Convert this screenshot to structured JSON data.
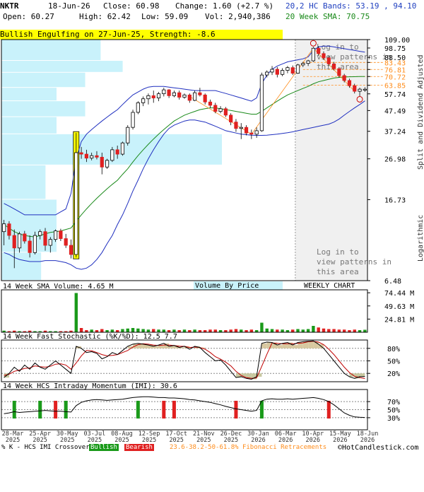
{
  "header": {
    "symbol": "NKTR",
    "date": "18-Jun-26",
    "close": "Close: 60.98",
    "change": "Change: 1.60 (+2.7 %)",
    "open": "Open: 60.27",
    "high": "High: 62.42",
    "low": "Low: 59.09",
    "vol": "Vol: 2,940,386",
    "bands": "20,2 HC Bands: 53.19 , 94.10",
    "sma": "20 Week SMA: 70.75"
  },
  "pattern_label": "Bullish Engulfing on 27-Jun-25, Strength: -8.6",
  "login_notice": "Log in to view patterns in this area",
  "side_labels": {
    "right_top": "Split and Dividend Adjusted",
    "right_bottom": "Logarithmic"
  },
  "colors": {
    "up": "#1a9a1a",
    "down": "#e02020",
    "sma": "#1a8a1a",
    "bands": "#1f2fbf",
    "vbp": "#c9f2fb",
    "fib": "#ff8c1a",
    "stoch_k": "#000000",
    "stoch_d": "#c00000",
    "highlight": "#ffff00"
  },
  "footer": {
    "legend": "% K - HCS IMI Crossover,",
    "bull": "Bullish",
    "bear": "Bearish",
    "fib": "23.6-38.2-50-61.8% Fibonacci Retracements",
    "copyright": "©HotCandlestick.com"
  },
  "chart_data": [
    {
      "type": "candlestick",
      "title": "NKTR",
      "yscale": "log",
      "ylim": [
        6.48,
        109.0
      ],
      "y_ticks": [
        "109.00",
        "98.75",
        "88.50",
        "83.43",
        "76.81",
        "70.72",
        "63.85",
        "57.74",
        "47.49",
        "37.24",
        "26.98",
        "16.73",
        "6.48"
      ],
      "fib_levels": [
        "83.43",
        "76.81",
        "70.72",
        "63.85"
      ],
      "x_labels": [
        "28-Mar\n2025",
        "25-Apr\n2025",
        "30-May\n2025",
        "03-Jul\n2025",
        "08-Aug\n2025",
        "12-Sep\n2025",
        "17-Oct\n2025",
        "21-Nov\n2025",
        "26-Dec\n2025",
        "30-Jan\n2026",
        "06-Mar\n2026",
        "10-Apr\n2026",
        "15-May\n2026",
        "18-Jun\n2026"
      ],
      "labels": {
        "volume_by_price": "Volume By Price",
        "chart_kind": "WEEKLY CHART"
      },
      "candles": [
        [
          11.5,
          13.2,
          9.8,
          12.6
        ],
        [
          12.6,
          13.0,
          10.5,
          11.0
        ],
        [
          11.0,
          11.8,
          7.5,
          9.5
        ],
        [
          9.5,
          11.5,
          9.0,
          11.2
        ],
        [
          11.2,
          11.6,
          10.0,
          10.3
        ],
        [
          10.3,
          11.0,
          8.5,
          9.0
        ],
        [
          9.0,
          11.5,
          8.8,
          11.0
        ],
        [
          11.0,
          11.8,
          10.5,
          11.5
        ],
        [
          11.5,
          12.0,
          9.2,
          9.8
        ],
        [
          9.8,
          10.8,
          9.0,
          10.5
        ],
        [
          10.5,
          11.8,
          10.2,
          11.6
        ],
        [
          11.6,
          11.9,
          10.3,
          10.6
        ],
        [
          10.6,
          11.2,
          9.5,
          9.8
        ],
        [
          9.8,
          10.5,
          8.4,
          8.8
        ],
        [
          8.8,
          36.5,
          8.5,
          29.0
        ],
        [
          29.0,
          31.0,
          27.0,
          28.5
        ],
        [
          28.5,
          30.0,
          26.0,
          27.2
        ],
        [
          27.2,
          29.0,
          26.5,
          28.0
        ],
        [
          28.0,
          29.5,
          26.8,
          27.5
        ],
        [
          27.5,
          29.0,
          22.5,
          24.5
        ],
        [
          24.5,
          27.0,
          24.0,
          26.5
        ],
        [
          26.5,
          31.0,
          26.0,
          30.0
        ],
        [
          30.0,
          31.5,
          27.0,
          28.5
        ],
        [
          28.5,
          33.0,
          28.0,
          32.5
        ],
        [
          32.5,
          40.0,
          31.5,
          39.0
        ],
        [
          39.0,
          48.0,
          38.0,
          46.5
        ],
        [
          46.5,
          53.0,
          45.5,
          52.0
        ],
        [
          52.0,
          56.0,
          50.0,
          54.5
        ],
        [
          54.5,
          58.0,
          51.0,
          56.5
        ],
        [
          56.5,
          60.0,
          52.0,
          55.0
        ],
        [
          55.0,
          59.0,
          53.0,
          57.8
        ],
        [
          57.8,
          62.0,
          56.0,
          60.5
        ],
        [
          60.5,
          61.0,
          55.0,
          56.5
        ],
        [
          56.5,
          60.0,
          55.5,
          58.5
        ],
        [
          58.5,
          60.0,
          54.0,
          55.5
        ],
        [
          55.5,
          58.0,
          54.5,
          57.0
        ],
        [
          57.0,
          58.0,
          52.0,
          53.5
        ],
        [
          53.5,
          60.0,
          53.0,
          58.5
        ],
        [
          58.5,
          62.0,
          56.0,
          57.0
        ],
        [
          57.0,
          58.0,
          51.0,
          52.5
        ],
        [
          52.5,
          54.0,
          49.0,
          50.5
        ],
        [
          50.5,
          52.0,
          46.0,
          47.0
        ],
        [
          47.0,
          50.0,
          46.0,
          48.5
        ],
        [
          48.5,
          49.5,
          44.0,
          45.0
        ],
        [
          45.0,
          46.0,
          40.0,
          41.5
        ],
        [
          41.5,
          43.0,
          37.0,
          38.5
        ],
        [
          38.5,
          41.0,
          34.0,
          39.0
        ],
        [
          39.0,
          40.0,
          35.5,
          36.5
        ],
        [
          36.5,
          38.0,
          34.0,
          36.0
        ],
        [
          36.0,
          39.0,
          34.5,
          37.5
        ],
        [
          37.5,
          74.0,
          37.0,
          72.0
        ],
        [
          72.0,
          76.0,
          70.0,
          74.5
        ],
        [
          74.5,
          80.0,
          72.0,
          77.0
        ],
        [
          77.0,
          79.0,
          70.0,
          72.5
        ],
        [
          72.5,
          78.0,
          71.0,
          76.0
        ],
        [
          76.0,
          80.0,
          73.5,
          78.5
        ],
        [
          78.5,
          80.5,
          72.0,
          73.5
        ],
        [
          73.5,
          82.0,
          73.0,
          81.0
        ],
        [
          81.0,
          84.0,
          79.0,
          82.5
        ],
        [
          82.5,
          86.0,
          80.0,
          85.0
        ],
        [
          85.0,
          100.0,
          84.0,
          98.5
        ],
        [
          98.5,
          101.0,
          90.0,
          92.5
        ],
        [
          92.5,
          95.0,
          86.0,
          88.0
        ],
        [
          88.0,
          90.0,
          80.0,
          82.0
        ],
        [
          82.0,
          84.0,
          76.0,
          77.5
        ],
        [
          77.5,
          79.0,
          70.0,
          71.5
        ],
        [
          71.5,
          73.0,
          66.0,
          67.5
        ],
        [
          67.5,
          69.0,
          62.0,
          63.5
        ],
        [
          63.5,
          65.0,
          58.0,
          59.5
        ],
        [
          59.5,
          62.0,
          56.0,
          61.0
        ],
        [
          60.3,
          62.4,
          59.1,
          60.98
        ]
      ],
      "sma_20": [
        12.5,
        12.0,
        11.5,
        11.2,
        11.0,
        10.9,
        10.8,
        11.0,
        11.2,
        11.4,
        11.5,
        11.6,
        11.8,
        12.0,
        13.0,
        14.0,
        15.0,
        16.0,
        17.0,
        18.0,
        19.0,
        20.0,
        21.0,
        22.5,
        24.0,
        26.0,
        28.0,
        30.0,
        32.0,
        34.0,
        36.0,
        38.0,
        40.0,
        42.0,
        43.5,
        45.0,
        46.0,
        47.0,
        48.0,
        48.5,
        49.0,
        49.0,
        48.5,
        48.0,
        47.5,
        47.0,
        46.5,
        46.0,
        45.5,
        45.5,
        47.0,
        49.0,
        51.0,
        53.0,
        55.0,
        57.0,
        58.5,
        60.0,
        61.5,
        63.0,
        65.0,
        66.5,
        67.5,
        68.5,
        69.5,
        70.0,
        70.3,
        70.5,
        70.6,
        70.7,
        70.75
      ],
      "band_upper": [
        16.0,
        15.5,
        15.0,
        14.5,
        14.0,
        14.0,
        14.0,
        14.0,
        14.0,
        14.0,
        14.0,
        14.5,
        15.0,
        18.0,
        27.0,
        33.0,
        36.0,
        38.0,
        40.0,
        42.0,
        44.0,
        46.0,
        48.0,
        51.0,
        54.0,
        57.0,
        59.0,
        61.0,
        62.5,
        63.0,
        63.0,
        63.0,
        62.5,
        62.0,
        61.5,
        61.0,
        60.5,
        60.0,
        60.0,
        60.0,
        60.0,
        60.0,
        59.0,
        58.0,
        57.0,
        56.0,
        55.0,
        54.0,
        53.0,
        55.0,
        65.0,
        72.0,
        77.0,
        80.0,
        82.0,
        84.0,
        85.0,
        86.0,
        87.0,
        89.0,
        96.0,
        100.0,
        101.0,
        101.0,
        100.0,
        99.0,
        98.0,
        97.0,
        96.0,
        95.0,
        94.1
      ],
      "band_lower": [
        9.0,
        8.8,
        8.5,
        8.3,
        8.2,
        8.1,
        8.1,
        8.1,
        8.2,
        8.2,
        8.2,
        8.1,
        8.0,
        7.8,
        7.5,
        7.4,
        7.5,
        7.8,
        8.3,
        9.0,
        10.0,
        11.0,
        12.5,
        14.0,
        16.0,
        18.5,
        21.0,
        24.0,
        27.0,
        30.0,
        33.0,
        36.0,
        38.5,
        40.0,
        41.0,
        42.0,
        42.5,
        42.5,
        42.0,
        41.5,
        40.5,
        39.5,
        38.5,
        37.5,
        37.0,
        36.5,
        36.0,
        35.8,
        35.6,
        35.5,
        35.5,
        35.6,
        35.8,
        36.0,
        36.3,
        36.6,
        37.0,
        37.5,
        38.0,
        38.5,
        39.0,
        39.5,
        40.0,
        40.5,
        41.5,
        43.0,
        45.0,
        47.0,
        49.0,
        51.0,
        53.19
      ],
      "volume_by_price": [
        {
          "low": 6.48,
          "high": 9.0,
          "value": 0.18
        },
        {
          "low": 9.0,
          "high": 16.73,
          "value": 0.25
        },
        {
          "low": 16.73,
          "high": 25.0,
          "value": 0.2
        },
        {
          "low": 25.0,
          "high": 36.0,
          "value": 1.0
        },
        {
          "low": 36.0,
          "high": 44.0,
          "value": 0.25
        },
        {
          "low": 44.0,
          "high": 53.0,
          "value": 0.38
        },
        {
          "low": 53.0,
          "high": 62.0,
          "value": 0.25
        },
        {
          "low": 62.0,
          "high": 74.0,
          "value": 0.38
        },
        {
          "low": 74.0,
          "high": 85.0,
          "value": 0.55
        },
        {
          "low": 85.0,
          "high": 109.0,
          "value": 0.45
        }
      ]
    },
    {
      "type": "bar",
      "title": "14 Week SMA Volume: 4.65 M",
      "y_ticks": [
        "74.44 M",
        "49.63 M",
        "24.81 M"
      ],
      "ylim": [
        0,
        80
      ],
      "values": [
        3,
        2,
        3,
        2,
        2,
        3,
        2,
        2,
        3,
        2,
        2,
        2,
        2,
        3,
        74,
        8,
        4,
        5,
        4,
        6,
        4,
        5,
        4,
        6,
        7,
        8,
        7,
        6,
        5,
        6,
        5,
        5,
        4,
        5,
        4,
        5,
        4,
        5,
        4,
        4,
        5,
        5,
        4,
        4,
        5,
        6,
        5,
        4,
        5,
        4,
        18,
        7,
        6,
        5,
        5,
        4,
        5,
        6,
        5,
        6,
        12,
        9,
        7,
        6,
        6,
        5,
        5,
        4,
        5,
        4,
        4.65
      ]
    },
    {
      "type": "line",
      "title": "14 Week Fast Stochastic (%K/%D): 12.5 7.7",
      "y_ticks": [
        "80%",
        "50%",
        "20%"
      ],
      "ylim": [
        0,
        100
      ],
      "series": [
        {
          "name": "%K",
          "values": [
            10,
            20,
            35,
            25,
            40,
            30,
            45,
            35,
            30,
            40,
            50,
            40,
            30,
            20,
            85,
            80,
            70,
            72,
            68,
            55,
            60,
            70,
            65,
            75,
            85,
            90,
            92,
            90,
            88,
            85,
            88,
            92,
            85,
            87,
            82,
            85,
            78,
            85,
            82,
            70,
            60,
            50,
            52,
            40,
            25,
            10,
            12,
            8,
            6,
            12,
            92,
            95,
            94,
            88,
            92,
            94,
            88,
            94,
            96,
            97,
            98,
            90,
            80,
            65,
            50,
            35,
            20,
            12,
            8,
            12,
            12.5
          ]
        },
        {
          "name": "%D",
          "values": [
            15,
            18,
            25,
            28,
            32,
            33,
            38,
            36,
            35,
            37,
            42,
            43,
            40,
            30,
            45,
            62,
            75,
            74,
            70,
            65,
            62,
            63,
            65,
            70,
            75,
            83,
            89,
            91,
            90,
            88,
            87,
            88,
            88,
            87,
            85,
            85,
            82,
            83,
            82,
            78,
            70,
            60,
            54,
            47,
            38,
            25,
            15,
            10,
            8,
            9,
            37,
            66,
            93,
            92,
            91,
            91,
            91,
            92,
            93,
            96,
            97,
            95,
            89,
            78,
            65,
            50,
            35,
            22,
            13,
            10,
            7.7
          ]
        }
      ]
    },
    {
      "type": "line",
      "title": "14 Week HCS Intraday Momentum (IMI): 30.6",
      "y_ticks": [
        "70%",
        "50%",
        "30%"
      ],
      "ylim": [
        0,
        100
      ],
      "series": [
        {
          "name": "IMI",
          "values": [
            40,
            42,
            45,
            43,
            44,
            45,
            46,
            47,
            48,
            47,
            46,
            46,
            45,
            44,
            60,
            68,
            72,
            74,
            75,
            74,
            73,
            74,
            75,
            76,
            78,
            80,
            81,
            82,
            82,
            81,
            80,
            80,
            79,
            79,
            78,
            77,
            75,
            74,
            72,
            70,
            68,
            65,
            62,
            58,
            55,
            52,
            50,
            48,
            46,
            48,
            72,
            76,
            77,
            76,
            76,
            77,
            76,
            77,
            78,
            79,
            80,
            78,
            75,
            70,
            62,
            52,
            42,
            36,
            32,
            31,
            30.6
          ]
        }
      ],
      "crossover_bullish": [
        2,
        7,
        12,
        26,
        50
      ],
      "crossover_bearish": [
        10,
        31,
        33,
        45,
        63
      ]
    }
  ]
}
